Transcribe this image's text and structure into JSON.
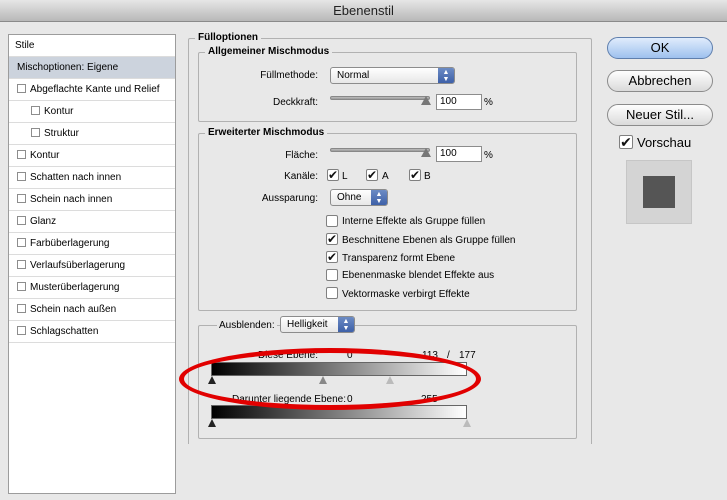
{
  "window": {
    "title": "Ebenenstil"
  },
  "style_list": {
    "header": "Stile",
    "items": [
      {
        "label": "Mischoptionen: Eigene",
        "checkbox": false,
        "selected": true,
        "sub": false
      },
      {
        "label": "Abgeflachte Kante und Relief",
        "checkbox": true,
        "selected": false,
        "sub": false
      },
      {
        "label": "Kontur",
        "checkbox": true,
        "selected": false,
        "sub": true
      },
      {
        "label": "Struktur",
        "checkbox": true,
        "selected": false,
        "sub": true
      },
      {
        "label": "Kontur",
        "checkbox": true,
        "selected": false,
        "sub": false
      },
      {
        "label": "Schatten nach innen",
        "checkbox": true,
        "selected": false,
        "sub": false
      },
      {
        "label": "Schein nach innen",
        "checkbox": true,
        "selected": false,
        "sub": false
      },
      {
        "label": "Glanz",
        "checkbox": true,
        "selected": false,
        "sub": false
      },
      {
        "label": "Farbüberlagerung",
        "checkbox": true,
        "selected": false,
        "sub": false
      },
      {
        "label": "Verlaufsüberlagerung",
        "checkbox": true,
        "selected": false,
        "sub": false
      },
      {
        "label": "Musterüberlagerung",
        "checkbox": true,
        "selected": false,
        "sub": false
      },
      {
        "label": "Schein nach außen",
        "checkbox": true,
        "selected": false,
        "sub": false
      },
      {
        "label": "Schlagschatten",
        "checkbox": true,
        "selected": false,
        "sub": false
      }
    ]
  },
  "fill_options": {
    "title": "Fülloptionen",
    "general": {
      "title": "Allgemeiner Mischmodus",
      "blend_mode_label": "Füllmethode:",
      "blend_mode_value": "Normal",
      "opacity_label": "Deckkraft:",
      "opacity_value": "100",
      "opacity_unit": "%"
    },
    "advanced": {
      "title": "Erweiterter Mischmodus",
      "fill_label": "Fläche:",
      "fill_value": "100",
      "fill_unit": "%",
      "channels_label": "Kanäle:",
      "channels": [
        {
          "name": "L",
          "checked": true
        },
        {
          "name": "A",
          "checked": true
        },
        {
          "name": "B",
          "checked": true
        }
      ],
      "knockout_label": "Aussparung:",
      "knockout_value": "Ohne",
      "options": [
        {
          "label": "Interne Effekte als Gruppe füllen",
          "checked": false
        },
        {
          "label": "Beschnittene Ebenen als Gruppe füllen",
          "checked": true
        },
        {
          "label": "Transparenz formt Ebene",
          "checked": true
        },
        {
          "label": "Ebenenmaske blendet Effekte aus",
          "checked": false
        },
        {
          "label": "Vektormaske verbirgt Effekte",
          "checked": false
        }
      ]
    },
    "blend_if": {
      "label": "Ausblenden:",
      "value": "Helligkeit",
      "this_layer_label": "Diese Ebene:",
      "this_layer_black": "0",
      "this_layer_white_low": "113",
      "this_layer_sep": "/",
      "this_layer_white_high": "177",
      "underlying_label": "Darunter liegende Ebene:",
      "underlying_black": "0",
      "underlying_white": "255"
    }
  },
  "buttons": {
    "ok": "OK",
    "cancel": "Abbrechen",
    "new_style": "Neuer Stil...",
    "preview_label": "Vorschau",
    "preview_checked": true
  },
  "check_glyph": "✔",
  "colors": {
    "selection": "#ccd3dd",
    "accent_blue": "#3d60a8",
    "annotation_red": "#e10000"
  }
}
